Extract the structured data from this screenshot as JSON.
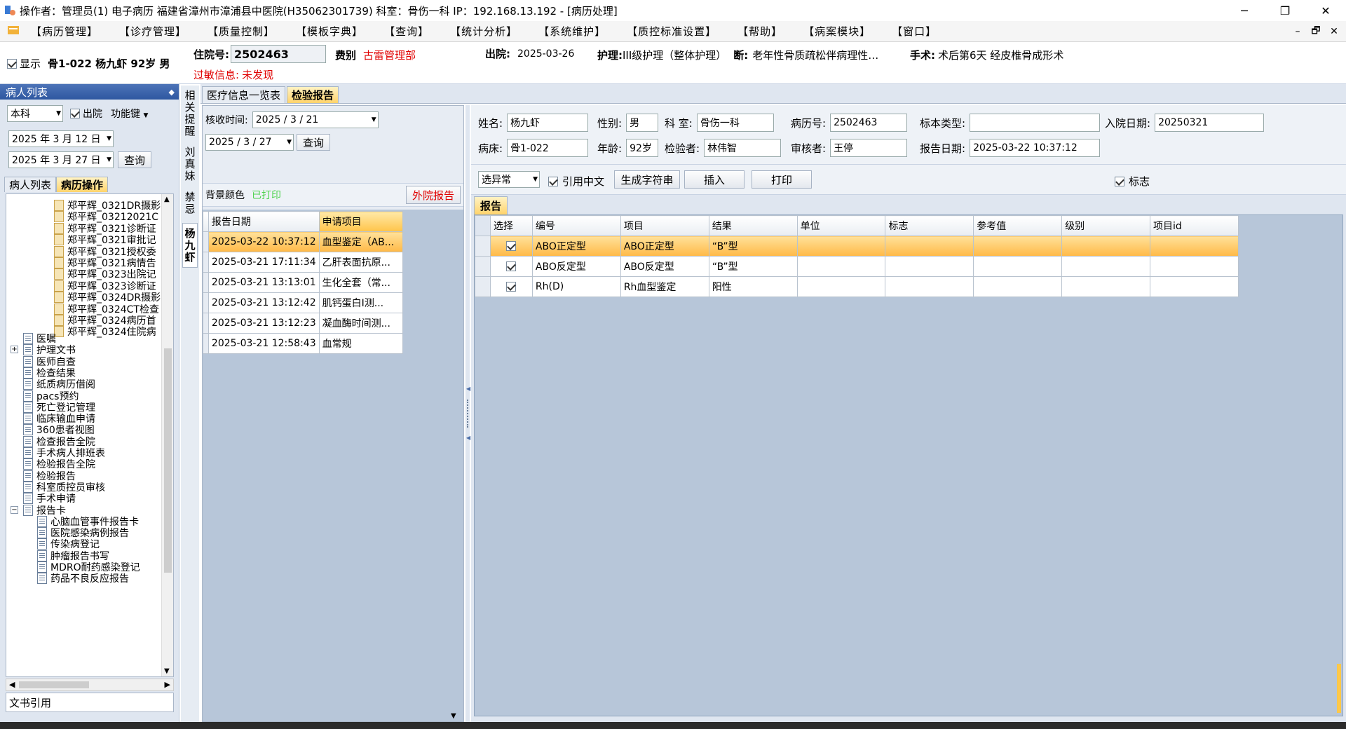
{
  "window": {
    "title": "操作者：管理员(1) 电子病历  福建省漳州市漳浦县中医院(H35062301739)  科室：骨伤一科  IP：192.168.13.192 - [病历处理]",
    "min": "─",
    "max": "❐",
    "close": "✕"
  },
  "menu": [
    "【病历管理】",
    "【诊疗管理】",
    "【质量控制】",
    "【模板字典】",
    "【查询】",
    "【统计分析】",
    "【系统维护】",
    "【质控标准设置】",
    "【帮助】",
    "【病案模块】",
    "【窗口】"
  ],
  "mdi": {
    "min": "–",
    "restore": "🗗",
    "close": "✕"
  },
  "patient": {
    "show_label": "显示",
    "bed_name": "骨1-022  杨九虾  92岁  男",
    "admit_label": "住院号:",
    "admit_no": "2502463",
    "fee_label": "费别",
    "fee_value": "古雷管理部",
    "discharge_label": "出院:",
    "discharge_value": "2025-03-26",
    "nursing_label": "护理:",
    "nursing_value": "III级护理（整体护理）",
    "diag_label": "断:",
    "diag_value": "老年性骨质疏松伴病理性…",
    "surgery_label": "手术:",
    "surgery_value": "术后第6天  经皮椎骨成形术",
    "allergy_label": "过敏信息:",
    "allergy_value": "未发现"
  },
  "left": {
    "header": "病人列表",
    "pin": "📌",
    "dept": "本科",
    "discharged_label": "出院",
    "func_key": "功能键",
    "date_from": "2025 年 3 月 12 日",
    "date_to": "2025 年 3 月 27 日",
    "query": "查询",
    "tabs": [
      "病人列表",
      "病历操作"
    ],
    "footer": "文书引用",
    "docs": [
      "郑平辉_0321DR摄影",
      "郑平辉_03212021C",
      "郑平辉_0321诊断证",
      "郑平辉_0321审批记",
      "郑平辉_0321授权委",
      "郑平辉_0321病情告",
      "郑平辉_0323出院记",
      "郑平辉_0323诊断证",
      "郑平辉_0324DR摄影",
      "郑平辉_0324CT检查",
      "郑平辉_0324病历首",
      "郑平辉_0324住院病"
    ],
    "nodes": [
      "医嘱",
      "护理文书",
      "医师自查",
      "检查结果",
      "纸质病历借阅",
      "pacs预约",
      "死亡登记管理",
      "临床输血申请",
      "360患者视图",
      "检查报告全院",
      "手术病人排班表",
      "检验报告全院",
      "检验报告",
      "科室质控员审核",
      "手术申请",
      "报告卡"
    ],
    "subnodes": [
      "心脑血管事件报告卡",
      "医院感染病例报告",
      "传染病登记",
      "肿瘤报告书写",
      "MDRO耐药感染登记",
      "药品不良反应报告"
    ]
  },
  "vtabs": [
    "相关提醒",
    "刘真妹",
    "禁忌",
    "杨九虾"
  ],
  "main_tabs": [
    "医疗信息一览表",
    "检验报告"
  ],
  "mid": {
    "check_time_label": "核收时间:",
    "date1": "2025 / 3 / 21",
    "date2": "2025 / 3 / 27",
    "query": "查询",
    "bg_label": "背景颜色",
    "printed": "已打印",
    "outside_btn": "外院报告",
    "col1": "报告日期",
    "col2": "申请项目",
    "rows": [
      [
        "2025-03-22 10:37:12",
        "血型鉴定（AB..."
      ],
      [
        "2025-03-21 17:11:34",
        "乙肝表面抗原..."
      ],
      [
        "2025-03-21 13:13:01",
        "生化全套（常..."
      ],
      [
        "2025-03-21 13:12:42",
        "肌钙蛋白I测..."
      ],
      [
        "2025-03-21 13:12:23",
        "凝血酶时间测..."
      ],
      [
        "2025-03-21 12:58:43",
        "血常规"
      ]
    ]
  },
  "report": {
    "name_l": "姓名:",
    "name": "杨九虾",
    "sex_l": "性别:",
    "sex": "男",
    "dept_l": "科  室:",
    "dept": "骨伤一科",
    "mrn_l": "病历号:",
    "mrn": "2502463",
    "spec_l": "标本类型:",
    "spec": "",
    "admit_l": "入院日期:",
    "admit": "20250321",
    "bed_l": "病床:",
    "bed": "骨1-022",
    "age_l": "年龄:",
    "age": "92岁",
    "tester_l": "检验者:",
    "tester": "林伟智",
    "reviewer_l": "审核者:",
    "reviewer": "王停",
    "rdate_l": "报告日期:",
    "rdate": "2025-03-22 10:37:12",
    "filter": "选异常",
    "cite_cn": "引用中文",
    "gen_btn": "生成字符串",
    "insert_btn": "插入",
    "print_btn": "打印",
    "flag_label": "标志",
    "tab": "报告",
    "cols": [
      "选择",
      "编号",
      "项目",
      "结果",
      "单位",
      "标志",
      "参考值",
      "级别",
      "项目id"
    ],
    "rows": [
      [
        "ABO正定型",
        "ABO正定型",
        "“B”型"
      ],
      [
        "ABO反定型",
        "ABO反定型",
        "“B”型"
      ],
      [
        "Rh(D)",
        "Rh血型鉴定",
        "阳性"
      ]
    ]
  }
}
